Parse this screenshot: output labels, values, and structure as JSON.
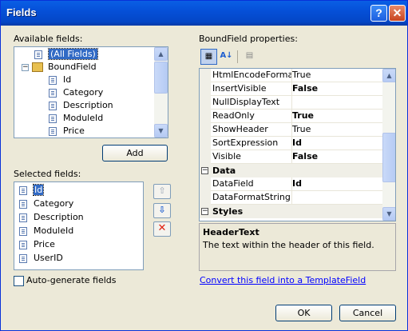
{
  "window": {
    "title": "Fields",
    "help_glyph": "?",
    "close_glyph": "✕"
  },
  "available": {
    "label": "Available fields:",
    "items": [
      {
        "label": "(All Fields)",
        "icon": "table-icon"
      },
      {
        "label": "BoundField",
        "icon": "folder-field-icon"
      },
      {
        "label": "Id"
      },
      {
        "label": "Category"
      },
      {
        "label": "Description"
      },
      {
        "label": "ModuleId"
      },
      {
        "label": "Price"
      }
    ],
    "add_label": "Add"
  },
  "selected": {
    "label": "Selected fields:",
    "items": [
      "Id",
      "Category",
      "Description",
      "ModuleId",
      "Price",
      "UserID"
    ],
    "move_up_glyph": "⇧",
    "move_down_glyph": "⇩",
    "delete_glyph": "✕"
  },
  "autogen": {
    "label": "Auto-generate fields",
    "checked": false
  },
  "properties": {
    "label": "BoundField properties:",
    "toolbar": {
      "categorized_glyph": "▦",
      "alpha_glyph": "A↓",
      "pages_glyph": "▤"
    },
    "rows": [
      {
        "type": "prop",
        "name": "HtmlEncodeFormatS",
        "value": "True",
        "bold": false
      },
      {
        "type": "prop",
        "name": "InsertVisible",
        "value": "False",
        "bold": true
      },
      {
        "type": "prop",
        "name": "NullDisplayText",
        "value": "",
        "bold": false
      },
      {
        "type": "prop",
        "name": "ReadOnly",
        "value": "True",
        "bold": true
      },
      {
        "type": "prop",
        "name": "ShowHeader",
        "value": "True",
        "bold": false
      },
      {
        "type": "prop",
        "name": "SortExpression",
        "value": "Id",
        "bold": true
      },
      {
        "type": "prop",
        "name": "Visible",
        "value": "False",
        "bold": true
      },
      {
        "type": "cat",
        "name": "Data",
        "expander": "−"
      },
      {
        "type": "prop",
        "name": "DataField",
        "value": "Id",
        "bold": true
      },
      {
        "type": "prop",
        "name": "DataFormatString",
        "value": "",
        "bold": false
      },
      {
        "type": "cat",
        "name": "Styles",
        "expander": "−"
      }
    ],
    "description_title": "HeaderText",
    "description_text": "The text within the header of this field."
  },
  "convert_link": "Convert this field into a TemplateField",
  "buttons": {
    "ok": "OK",
    "cancel": "Cancel"
  },
  "colors": {
    "title_bar": "#0550d8",
    "selection": "#316ac5",
    "dialog_bg": "#ece9d8",
    "link": "#0000ff"
  }
}
